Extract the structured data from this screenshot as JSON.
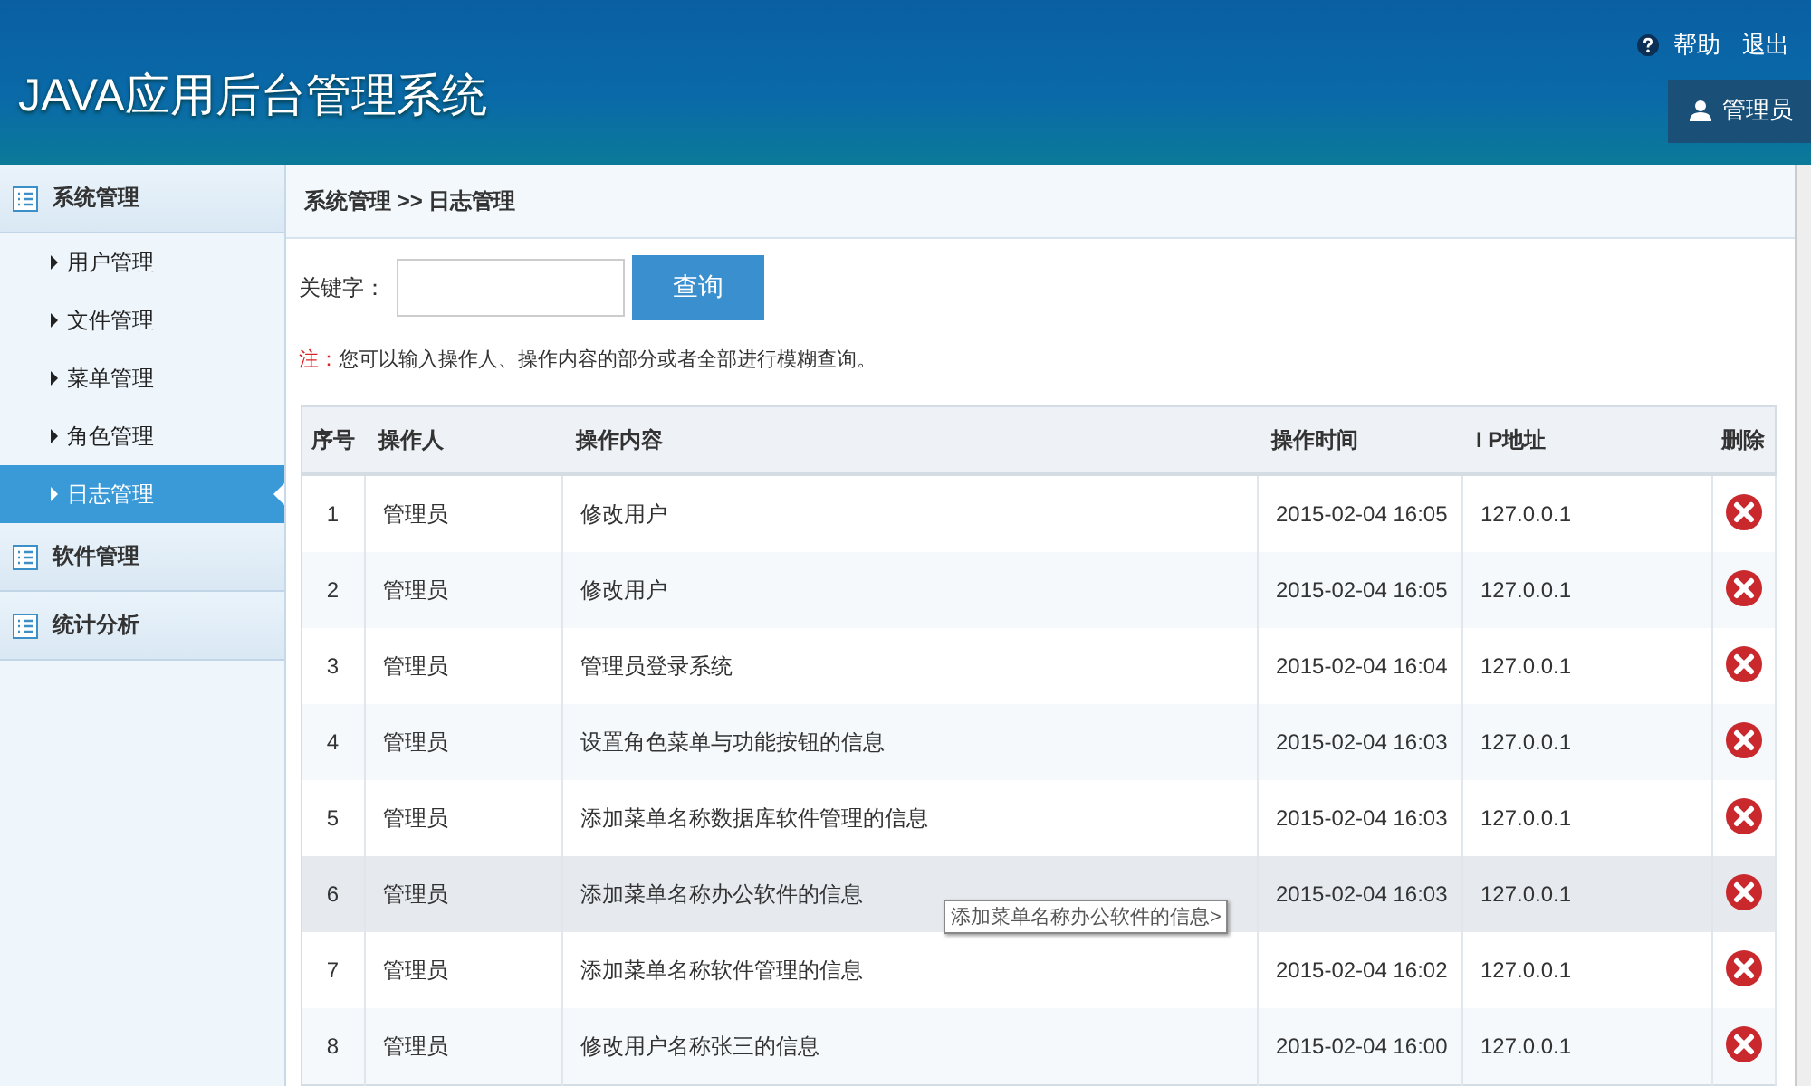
{
  "header": {
    "title": "JAVA应用后台管理系统",
    "links": [
      "帮助",
      "退出"
    ],
    "user": "管理员"
  },
  "sidebar": {
    "groups": [
      {
        "label": "系统管理",
        "children": [
          {
            "label": "用户管理",
            "selected": false
          },
          {
            "label": "文件管理",
            "selected": false
          },
          {
            "label": "菜单管理",
            "selected": false
          },
          {
            "label": "角色管理",
            "selected": false
          },
          {
            "label": "日志管理",
            "selected": true
          }
        ]
      },
      {
        "label": "软件管理"
      },
      {
        "label": "统计分析"
      }
    ]
  },
  "breadcrumb": "系统管理 >> 日志管理",
  "search": {
    "label": "关键字：",
    "button": "查询"
  },
  "note": {
    "mark": "注：",
    "text": "您可以输入操作人、操作内容的部分或者全部进行模糊查询。"
  },
  "table": {
    "columns": [
      "序号",
      "操作人",
      "操作内容",
      "操作时间",
      "I P地址",
      "删除"
    ],
    "rows": [
      {
        "no": "1",
        "user": "管理员",
        "content": "修改用户",
        "time": "2015-02-04 16:05",
        "ip": "127.0.0.1",
        "hovered": false
      },
      {
        "no": "2",
        "user": "管理员",
        "content": "修改用户",
        "time": "2015-02-04 16:05",
        "ip": "127.0.0.1",
        "hovered": false
      },
      {
        "no": "3",
        "user": "管理员",
        "content": "管理员登录系统",
        "time": "2015-02-04 16:04",
        "ip": "127.0.0.1",
        "hovered": false
      },
      {
        "no": "4",
        "user": "管理员",
        "content": "设置角色菜单与功能按钮的信息",
        "time": "2015-02-04 16:03",
        "ip": "127.0.0.1",
        "hovered": false
      },
      {
        "no": "5",
        "user": "管理员",
        "content": "添加菜单名称数据库软件管理的信息",
        "time": "2015-02-04 16:03",
        "ip": "127.0.0.1",
        "hovered": false
      },
      {
        "no": "6",
        "user": "管理员",
        "content": "添加菜单名称办公软件的信息",
        "time": "2015-02-04 16:03",
        "ip": "127.0.0.1",
        "hovered": true
      },
      {
        "no": "7",
        "user": "管理员",
        "content": "添加菜单名称软件管理的信息",
        "time": "2015-02-04 16:02",
        "ip": "127.0.0.1",
        "hovered": false
      },
      {
        "no": "8",
        "user": "管理员",
        "content": "修改用户名称张三的信息",
        "time": "2015-02-04 16:00",
        "ip": "127.0.0.1",
        "hovered": false
      }
    ]
  },
  "tooltip": "添加菜单名称办公软件的信息>"
}
